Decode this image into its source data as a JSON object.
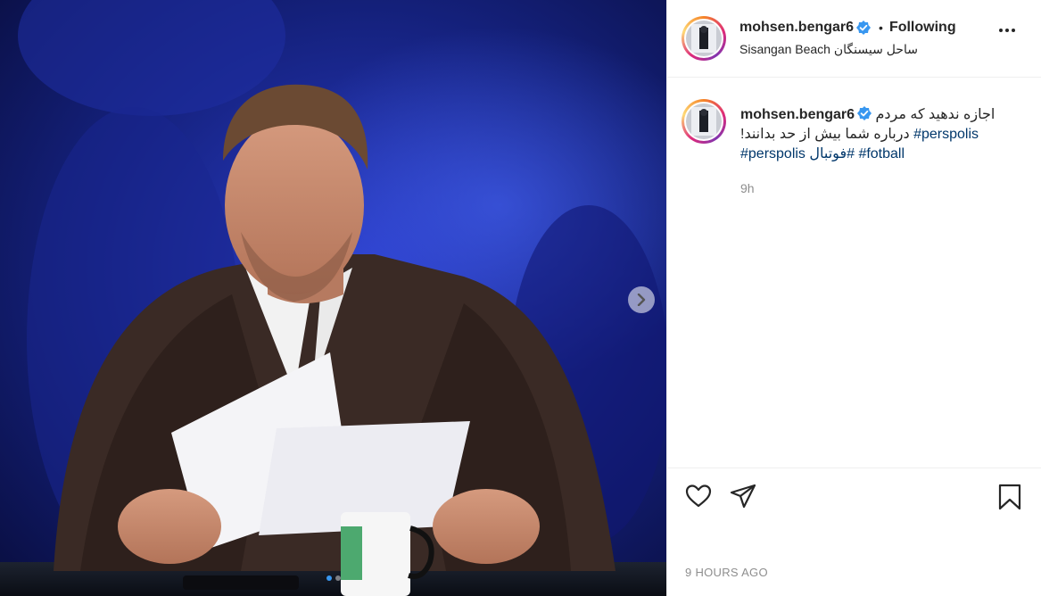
{
  "post": {
    "author": {
      "username": "mohsen.bengar6",
      "verified_icon": "verified-badge-icon",
      "follow_status": "Following",
      "separator": "•",
      "location": "Sisangan Beach ساحل سیسنگان"
    },
    "caption": {
      "line1": "اجازه ندهید که مردم",
      "line2_text": "درباره شما بیش از حد بدانند!",
      "line2_tag": "#perspolis",
      "tags": [
        "#perspolis",
        "#فوتبال",
        "#fotball"
      ],
      "time": "9h"
    },
    "actions": {
      "like_icon": "heart-icon",
      "share_icon": "paper-plane-icon",
      "save_icon": "bookmark-icon"
    },
    "timestamp": "9 HOURS AGO",
    "carousel": {
      "total_slides": 2,
      "current_slide": 1,
      "next_icon": "chevron-right-icon"
    },
    "colors": {
      "accent": "#3897f0",
      "hashtag": "#00376b",
      "secondary_text": "#8e8e8e",
      "border": "#efefef"
    }
  }
}
